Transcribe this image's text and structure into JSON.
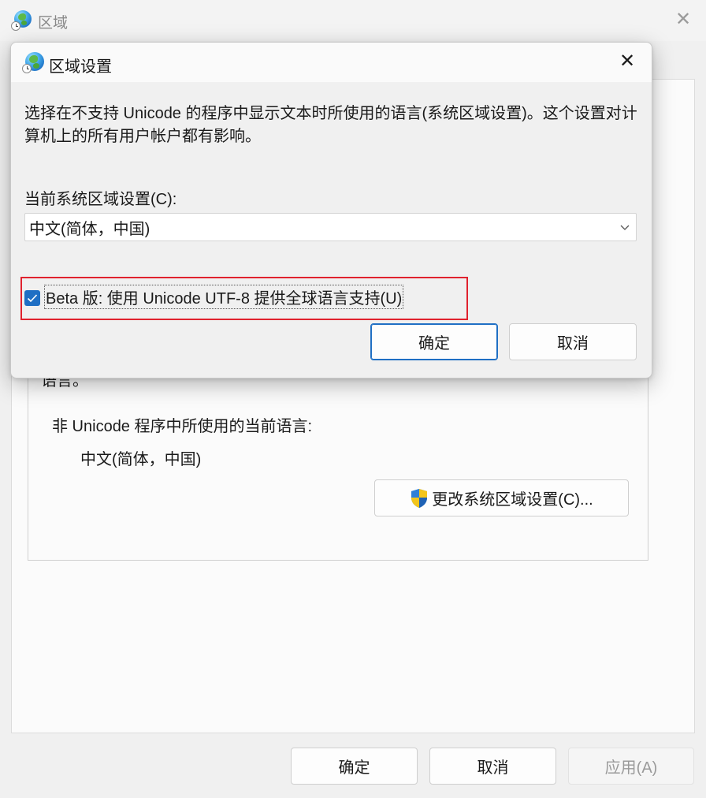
{
  "outer_window": {
    "title": "区域",
    "partial_text": "语言。",
    "nonunicode_label": "非 Unicode 程序中所使用的当前语言:",
    "current_language": "中文(简体，中国)",
    "change_locale_button": "更改系统区域设置(C)...",
    "footer": {
      "ok": "确定",
      "cancel": "取消",
      "apply": "应用(A)"
    }
  },
  "dialog": {
    "title": "区域设置",
    "description": "选择在不支持 Unicode 的程序中显示文本时所使用的语言(系统区域设置)。这个设置对计算机上的所有用户帐户都有影响。",
    "locale_label": "当前系统区域设置(C):",
    "locale_value": "中文(简体，中国)",
    "utf8_checkbox_label": "Beta 版: 使用 Unicode UTF-8 提供全球语言支持(U)",
    "utf8_checked": true,
    "ok": "确定",
    "cancel": "取消"
  },
  "colors": {
    "accent": "#1f6fc4",
    "highlight_border": "#e0222e"
  },
  "icons": {
    "title_icon": "globe-clock-icon",
    "close": "close-icon",
    "dropdown": "chevron-down-icon",
    "uac": "uac-shield-icon",
    "check": "checkmark-icon"
  }
}
